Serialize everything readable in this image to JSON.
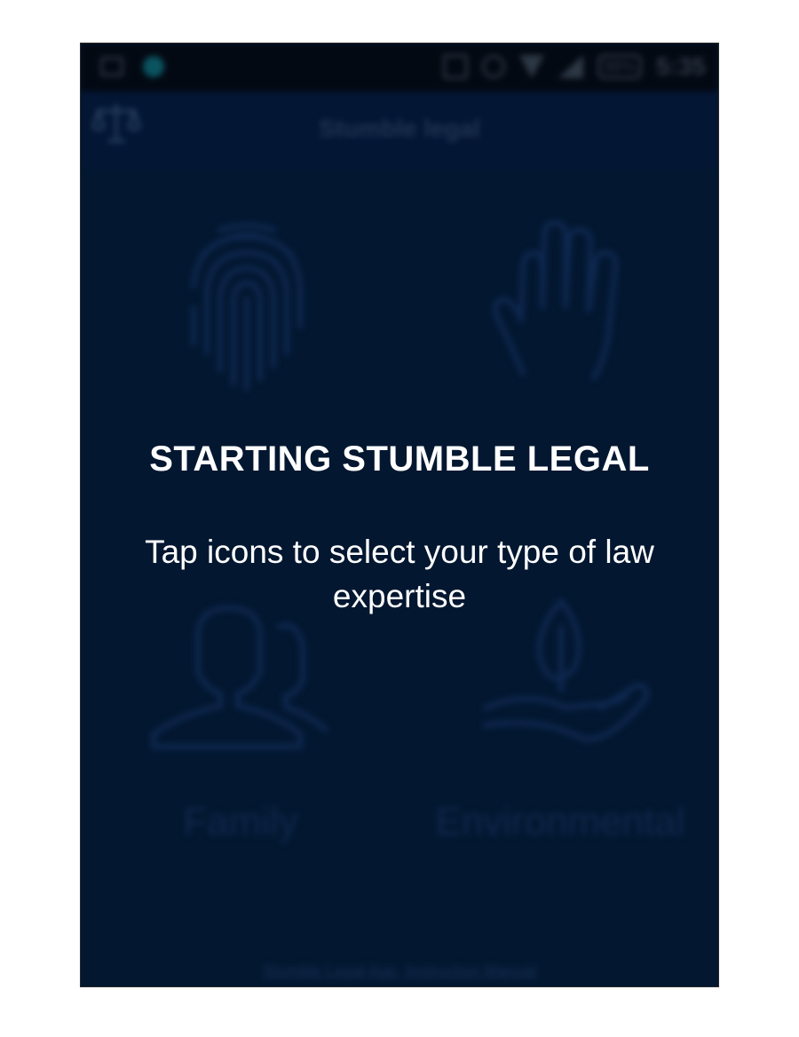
{
  "status_bar": {
    "time": "5:35",
    "battery": "98%",
    "icons": [
      "image-icon",
      "notification-dot-icon",
      "nfc-icon",
      "alarm-icon",
      "wifi-icon",
      "signal-icon",
      "battery-icon"
    ]
  },
  "toolbar": {
    "logo_icon": "scales-icon",
    "title": "Stumble legal"
  },
  "tiles": [
    {
      "label": "",
      "icon": "fingerprint-icon"
    },
    {
      "label": "",
      "icon": "hand-icon"
    },
    {
      "label": "Family",
      "icon": "person-icon"
    },
    {
      "label": "Environmental",
      "icon": "leaf-in-hand-icon"
    }
  ],
  "overlay": {
    "title": "STARTING STUMBLE LEGAL",
    "instruction": "Tap icons to select your type of law expertise"
  },
  "footer": {
    "link_text": "Stumble Legal App, Instruction Manual"
  },
  "colors": {
    "background": "#031a35",
    "status_bar": "#03070d",
    "overlay_text": "#ffffff",
    "icon_stroke": "#12305e"
  }
}
